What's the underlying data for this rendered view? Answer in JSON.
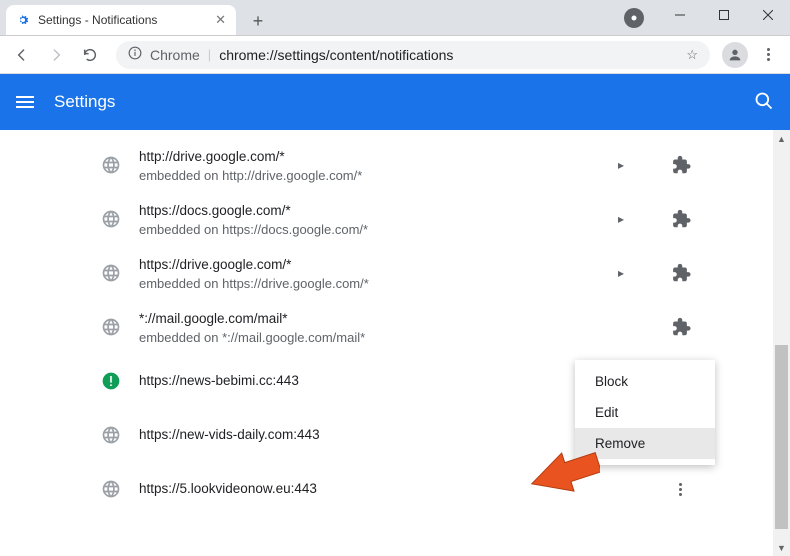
{
  "tab": {
    "title": "Settings - Notifications"
  },
  "omnibox": {
    "prefix": "Chrome",
    "path": "chrome://settings/content/notifications"
  },
  "settingsHeader": {
    "title": "Settings"
  },
  "sites": [
    {
      "url": "http://drive.google.com/*",
      "sub": "embedded on http://drive.google.com/*",
      "kind": "globe",
      "chevron": true,
      "ext": true
    },
    {
      "url": "https://docs.google.com/*",
      "sub": "embedded on https://docs.google.com/*",
      "kind": "globe",
      "chevron": true,
      "ext": true
    },
    {
      "url": "https://drive.google.com/*",
      "sub": "embedded on https://drive.google.com/*",
      "kind": "globe",
      "chevron": true,
      "ext": true
    },
    {
      "url": "*://mail.google.com/mail*",
      "sub": "embedded on *://mail.google.com/mail*",
      "kind": "globe",
      "chevron": false,
      "ext": true
    },
    {
      "url": "https://news-bebimi.cc:443",
      "sub": "",
      "kind": "green",
      "chevron": false,
      "ext": false
    },
    {
      "url": "https://new-vids-daily.com:443",
      "sub": "",
      "kind": "globe",
      "chevron": false,
      "ext": false
    },
    {
      "url": "https://5.lookvideonow.eu:443",
      "sub": "",
      "kind": "globe",
      "chevron": false,
      "ext": false,
      "more": true
    }
  ],
  "menu": {
    "block": "Block",
    "edit": "Edit",
    "remove": "Remove"
  }
}
